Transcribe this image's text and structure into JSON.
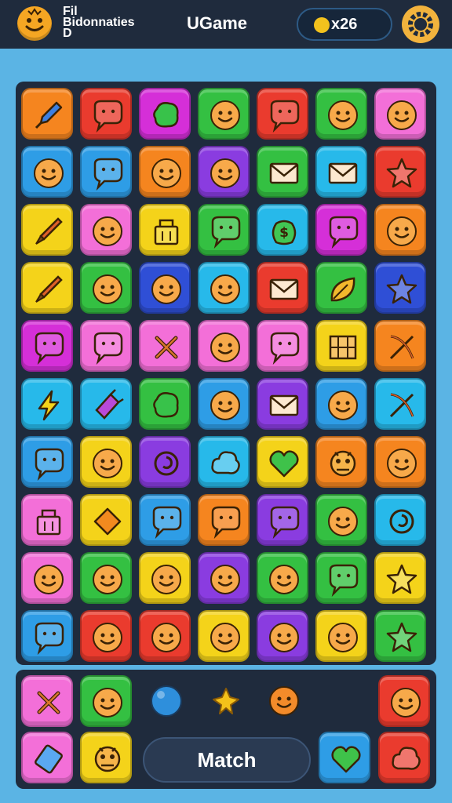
{
  "header": {
    "player_name_lines": [
      "Fil",
      "Bidonnaties",
      "D"
    ],
    "game_title": "UGame",
    "coin_count": "x26",
    "icons": [
      "avatar-smiley-icon",
      "coin-icon",
      "gear-icon"
    ]
  },
  "colors": {
    "orange": "#f5851f",
    "red": "#ea3b2e",
    "magenta": "#d52fd8",
    "green": "#34c042",
    "pink": "#f36fd8",
    "blue": "#2e9de6",
    "purple": "#8a3ce0",
    "yellow": "#f4d31a",
    "cyan": "#27b9ea",
    "darkblue": "#2f4fd6"
  },
  "board": {
    "rows": [
      [
        [
          "orange",
          "rocket"
        ],
        [
          "red",
          "chat-bubble"
        ],
        [
          "magenta",
          "blob"
        ],
        [
          "green",
          "smiley"
        ],
        [
          "red",
          "chat-bubble"
        ],
        [
          "green",
          "smiley"
        ],
        [
          "pink",
          "smiley"
        ]
      ],
      [
        [
          "blue",
          "smiley"
        ],
        [
          "blue",
          "chat-bubble"
        ],
        [
          "orange",
          "smiley"
        ],
        [
          "purple",
          "smiley"
        ],
        [
          "green",
          "envelope"
        ],
        [
          "cyan",
          "envelope"
        ],
        [
          "red",
          "star"
        ]
      ],
      [
        [
          "yellow",
          "brush"
        ],
        [
          "pink",
          "smiley"
        ],
        [
          "yellow",
          "basket"
        ],
        [
          "green",
          "chat-bubble"
        ],
        [
          "cyan",
          "dollar-bag"
        ],
        [
          "magenta",
          "chat-bubble"
        ],
        [
          "orange",
          "smiley"
        ]
      ],
      [
        [
          "yellow",
          "brush"
        ],
        [
          "green",
          "smiley"
        ],
        [
          "darkblue",
          "smiley"
        ],
        [
          "cyan",
          "smiley"
        ],
        [
          "red",
          "envelope"
        ],
        [
          "green",
          "leaf"
        ],
        [
          "darkblue",
          "star"
        ]
      ],
      [
        [
          "magenta",
          "chat-bubble"
        ],
        [
          "pink",
          "chat-bubble"
        ],
        [
          "pink",
          "cross-tools"
        ],
        [
          "pink",
          "smiley"
        ],
        [
          "pink",
          "chat-bubble"
        ],
        [
          "yellow",
          "grid"
        ],
        [
          "orange",
          "bow"
        ]
      ],
      [
        [
          "cyan",
          "lightning"
        ],
        [
          "cyan",
          "gift"
        ],
        [
          "green",
          "blob"
        ],
        [
          "blue",
          "smiley"
        ],
        [
          "purple",
          "envelope"
        ],
        [
          "blue",
          "smiley"
        ],
        [
          "cyan",
          "bow"
        ]
      ],
      [
        [
          "blue",
          "chat-bubble"
        ],
        [
          "yellow",
          "smiley"
        ],
        [
          "purple",
          "swirl"
        ],
        [
          "cyan",
          "cloud"
        ],
        [
          "yellow",
          "heart"
        ],
        [
          "orange",
          "monster"
        ],
        [
          "orange",
          "smiley"
        ]
      ],
      [
        [
          "pink",
          "basket"
        ],
        [
          "yellow",
          "diamond"
        ],
        [
          "blue",
          "chat-bubble"
        ],
        [
          "orange",
          "chat-bubble"
        ],
        [
          "purple",
          "chat-bubble"
        ],
        [
          "green",
          "smiley"
        ],
        [
          "cyan",
          "swirl"
        ]
      ],
      [
        [
          "pink",
          "smiley"
        ],
        [
          "green",
          "smiley"
        ],
        [
          "yellow",
          "smiley"
        ],
        [
          "purple",
          "smiley"
        ],
        [
          "green",
          "smiley"
        ],
        [
          "green",
          "chat-bubble"
        ],
        [
          "yellow",
          "star"
        ]
      ],
      [
        [
          "blue",
          "chat-bubble"
        ],
        [
          "red",
          "smiley"
        ],
        [
          "red",
          "smiley"
        ],
        [
          "yellow",
          "smiley"
        ],
        [
          "purple",
          "smiley"
        ],
        [
          "yellow",
          "smiley"
        ],
        [
          "green",
          "star"
        ]
      ]
    ]
  },
  "tray": {
    "tiles": [
      [
        "pink",
        "cross-tools"
      ],
      [
        "green",
        "smiley"
      ],
      [
        "red",
        "smiley"
      ],
      [
        "pink",
        "gem"
      ],
      [
        "yellow",
        "monster"
      ],
      [
        "blue",
        "heart"
      ],
      [
        "red",
        "cloud"
      ]
    ],
    "tokens": [
      "blue-orb-icon",
      "yellow-star-icon",
      "orange-smiley-icon"
    ],
    "match_label": "Match"
  }
}
